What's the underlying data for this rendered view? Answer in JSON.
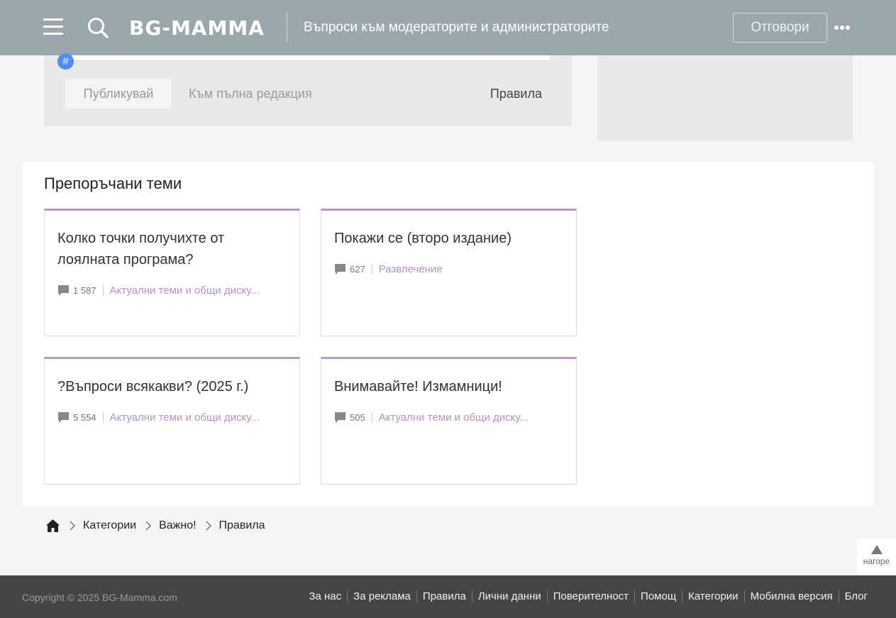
{
  "header": {
    "logo_text": "BG-MAMMA",
    "thread_title": "Въпроси към модераторите и администраторите",
    "reply_label": "Отговори"
  },
  "reply_panel": {
    "hash_symbol": "#",
    "publish_label": "Публикувай",
    "full_edit_label": "Към пълна редакция",
    "rules_label": "Правила"
  },
  "recommended": {
    "title": "Препоръчани теми",
    "cards": [
      {
        "title": "Колко точки получихте от лоялната програма?",
        "count": "1 587",
        "category": "Актуални теми и общи диску..."
      },
      {
        "title": "Покажи се (второ издание)",
        "count": "627",
        "category": "Развлечение"
      },
      {
        "title": "?Въпроси всякакви? (2025 г.)",
        "count": "5 554",
        "category": "Актуални теми и общи диску..."
      },
      {
        "title": "Внимавайте! Измамници!",
        "count": "505",
        "category": "Актуални теми и общи диску..."
      }
    ]
  },
  "breadcrumb": {
    "items": [
      "Категории",
      "Важно!",
      "Правила"
    ]
  },
  "to_top": {
    "label": "нагоре"
  },
  "footer": {
    "copyright": "Copyright © 2025 BG-Mamma.com",
    "links": [
      "За нас",
      "За реклама",
      "Правила",
      "Лични данни",
      "Поверителност",
      "Помощ",
      "Категории",
      "Мобилна версия",
      "Блог"
    ]
  },
  "colors": {
    "header_bg": "#9aa8ae",
    "accent_purple": "#b98dc6",
    "hash_blue": "#4e8df5",
    "footer_bg": "#454545"
  },
  "icons": [
    "menu-icon",
    "search-icon",
    "more-icon",
    "hash-icon",
    "comment-icon",
    "home-icon",
    "chevron-right-icon",
    "arrow-up-icon"
  ]
}
